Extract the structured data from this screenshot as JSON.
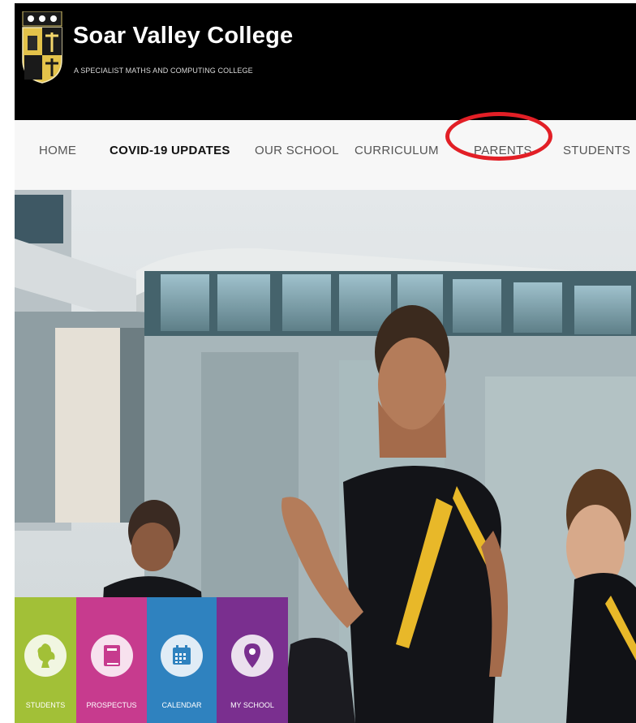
{
  "header": {
    "title": "Soar Valley College",
    "tagline": "A SPECIALIST MATHS AND COMPUTING COLLEGE",
    "background": "#000000"
  },
  "nav": {
    "items": [
      {
        "label": "HOME",
        "active": false
      },
      {
        "label": "COVID-19 UPDATES",
        "active": true
      },
      {
        "label": "OUR SCHOOL",
        "active": false
      },
      {
        "label": "CURRICULUM",
        "active": false
      },
      {
        "label": "PARENTS",
        "active": false,
        "highlighted": true
      },
      {
        "label": "STUDENTS",
        "active": false
      }
    ],
    "highlight_color": "#e21f26"
  },
  "hero": {
    "icon_names": [
      "school-building",
      "students-running"
    ]
  },
  "quick_links": [
    {
      "label": "STUDENTS",
      "icon": "lion-icon",
      "color": "#a2c037"
    },
    {
      "label": "PROSPECTUS",
      "icon": "book-icon",
      "color": "#c73b8e"
    },
    {
      "label": "CALENDAR",
      "icon": "calendar-icon",
      "color": "#2f82bf"
    },
    {
      "label": "MY SCHOOL",
      "icon": "map-pin-icon",
      "color": "#7a2f8f"
    }
  ]
}
